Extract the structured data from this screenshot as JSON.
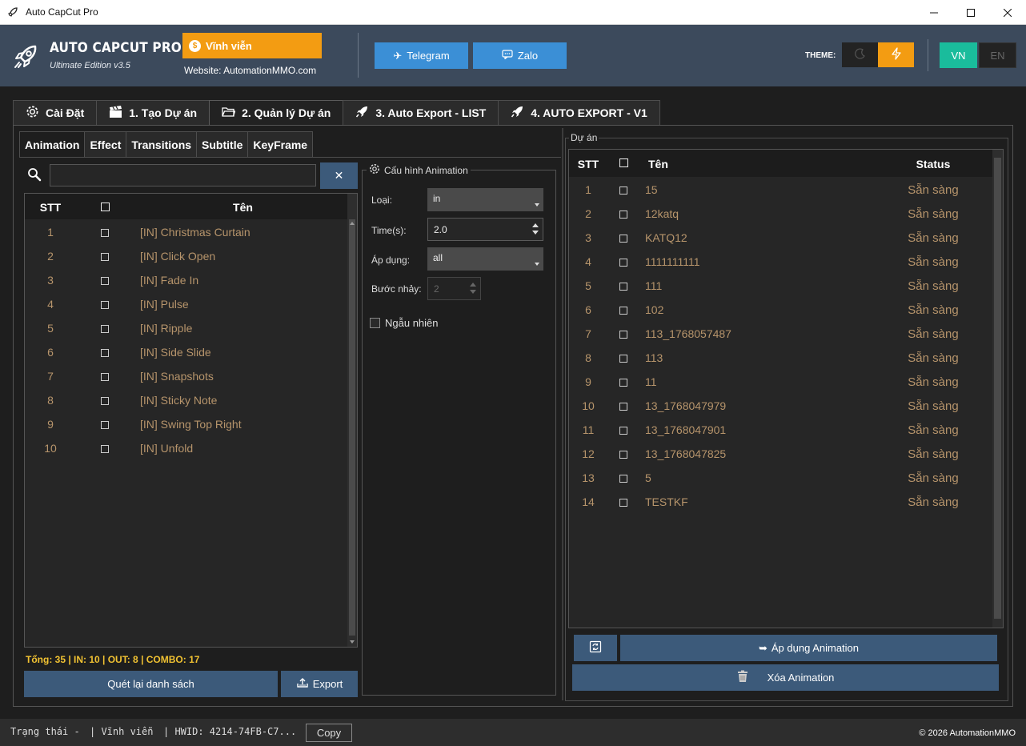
{
  "window": {
    "title": "Auto CapCut Pro",
    "controls": [
      "minimize",
      "maximize",
      "close"
    ]
  },
  "header": {
    "brand": "AUTO CAPCUT PRO",
    "edition": "Ultimate Edition v3.5",
    "license_label": "Vĩnh viễn",
    "website": "Website: AutomationMMO.com",
    "telegram_label": "Telegram",
    "zalo_label": "Zalo",
    "theme_label": "THEME:",
    "theme_options": [
      "moon-icon",
      "lightning-icon"
    ],
    "theme_active": "lightning",
    "lang_vn": "VN",
    "lang_en": "EN",
    "lang_active": "VN",
    "colors": {
      "header_bg": "#3c4a5c",
      "accent_orange": "#f39c12",
      "social_blue": "#3b8fd6",
      "lang_green": "#1abc9c"
    }
  },
  "main_tabs": [
    {
      "label": "Cài Đặt",
      "icon": "gear-icon"
    },
    {
      "label": "1. Tạo Dự án",
      "icon": "clapperboard-icon"
    },
    {
      "label": "2. Quản lý Dự án",
      "icon": "folder-icon",
      "active": true
    },
    {
      "label": "3. Auto Export - LIST",
      "icon": "rocket-icon"
    },
    {
      "label": "4. AUTO EXPORT - V1",
      "icon": "rocket-icon"
    }
  ],
  "sub_tabs": [
    {
      "label": "Animation",
      "active": true
    },
    {
      "label": "Effect"
    },
    {
      "label": "Transitions"
    },
    {
      "label": "Subtitle"
    },
    {
      "label": "KeyFrame"
    }
  ],
  "search": {
    "value": "",
    "placeholder": "",
    "clear_label": "✕"
  },
  "animation_list": {
    "headers": {
      "stt": "STT",
      "name": "Tên"
    },
    "rows": [
      {
        "stt": "1",
        "name": "[IN] Christmas Curtain"
      },
      {
        "stt": "2",
        "name": "[IN] Click Open"
      },
      {
        "stt": "3",
        "name": "[IN] Fade In"
      },
      {
        "stt": "4",
        "name": "[IN] Pulse"
      },
      {
        "stt": "5",
        "name": "[IN] Ripple"
      },
      {
        "stt": "6",
        "name": "[IN] Side Slide"
      },
      {
        "stt": "7",
        "name": "[IN] Snapshots"
      },
      {
        "stt": "8",
        "name": "[IN] Sticky Note"
      },
      {
        "stt": "9",
        "name": "[IN] Swing Top Right"
      },
      {
        "stt": "10",
        "name": "[IN] Unfold"
      }
    ]
  },
  "summary": "Tổng: 35 | IN: 10 | OUT: 8 | COMBO: 17",
  "rescan_label": "Quét lại danh sách",
  "export_label": "Export",
  "config": {
    "title": "Cấu hình Animation",
    "type_label": "Loại:",
    "type_value": "in",
    "time_label": "Time(s):",
    "time_value": "2.0",
    "apply_label": "Áp dụng:",
    "apply_value": "all",
    "step_label": "Bước nhảy:",
    "step_value": "2",
    "random_label": "Ngẫu nhiên",
    "random_checked": false
  },
  "projects": {
    "title": "Dự án",
    "headers": {
      "stt": "STT",
      "name": "Tên",
      "status": "Status"
    },
    "rows": [
      {
        "stt": "1",
        "name": "15",
        "status": "Sẵn sàng"
      },
      {
        "stt": "2",
        "name": "12katq",
        "status": "Sẵn sàng"
      },
      {
        "stt": "3",
        "name": "KATQ12",
        "status": "Sẵn sàng"
      },
      {
        "stt": "4",
        "name": "1111111111",
        "status": "Sẵn sàng"
      },
      {
        "stt": "5",
        "name": "111",
        "status": "Sẵn sàng"
      },
      {
        "stt": "6",
        "name": "102",
        "status": "Sẵn sàng"
      },
      {
        "stt": "7",
        "name": "113_1768057487",
        "status": "Sẵn sàng"
      },
      {
        "stt": "8",
        "name": "113",
        "status": "Sẵn sàng"
      },
      {
        "stt": "9",
        "name": "11",
        "status": "Sẵn sàng"
      },
      {
        "stt": "10",
        "name": "13_1768047979",
        "status": "Sẵn sàng"
      },
      {
        "stt": "11",
        "name": "13_1768047901",
        "status": "Sẵn sàng"
      },
      {
        "stt": "12",
        "name": "13_1768047825",
        "status": "Sẵn sàng"
      },
      {
        "stt": "13",
        "name": "5",
        "status": "Sẵn sàng"
      },
      {
        "stt": "14",
        "name": "TESTKF",
        "status": "Sẵn sàng"
      }
    ]
  },
  "actions": {
    "apply_animation_label": "Áp dụng Animation",
    "delete_animation_label": "Xóa Animation"
  },
  "status_bar": {
    "status": "Trạng thái -",
    "license": "| Vĩnh viễn",
    "hwid": "|  HWID: 4214-74FB-C7...",
    "copy_label": "Copy",
    "copyright": "© 2026 AutomationMMO"
  }
}
